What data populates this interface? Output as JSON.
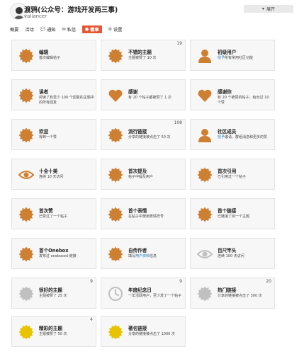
{
  "header": {
    "username": "渡鸦(公众号：游戏开发两三事)",
    "handle": "valiancer",
    "expand_label": "展开"
  },
  "nav": [
    {
      "label": "概要",
      "icon": "",
      "active": false
    },
    {
      "label": "活动",
      "icon": "",
      "active": false
    },
    {
      "label": "通知",
      "icon": "comment-icon",
      "active": false
    },
    {
      "label": "私信",
      "icon": "envelope-icon",
      "active": false
    },
    {
      "label": "徽章",
      "icon": "badge-icon",
      "active": true
    },
    {
      "label": "设置",
      "icon": "gear-icon",
      "active": false
    }
  ],
  "colors": {
    "bronze": "#cd7f32",
    "silver": "#c0c0c0",
    "gold": "#e7c300",
    "accent": "#e45735",
    "link": "#0a74b8"
  },
  "badges": [
    {
      "title": "编辑",
      "desc": "首次编辑帖子",
      "count": "",
      "icon": "cog-icon",
      "color": "bronze"
    },
    {
      "title": "不错的主题",
      "desc": "主题被赞了 10 次",
      "count": "19",
      "icon": "cog-icon",
      "color": "bronze"
    },
    {
      "title": "初级用户",
      "desc_link": "授予",
      "desc": "所有常用社区功能",
      "count": "",
      "icon": "user-icon",
      "color": "bronze"
    },
    {
      "title": "读者",
      "desc": "阅读了有至少 100 个回复的主题中的所有回复",
      "count": "",
      "icon": "cog-icon",
      "color": "bronze"
    },
    {
      "title": "感谢",
      "desc": "有 20 个帖子都被赞了 1 次",
      "count": "",
      "icon": "heart-icon",
      "color": "bronze"
    },
    {
      "title": "感谢你",
      "desc": "有 20 个被赞的帖子，给出过 10 个赞",
      "count": "",
      "icon": "heart-icon",
      "color": "bronze"
    },
    {
      "title": "欢迎",
      "desc": "得到一个赞",
      "count": "",
      "icon": "cog-icon",
      "color": "bronze"
    },
    {
      "title": "流行链接",
      "desc": "分享的链接被点击了 50 次",
      "count": "108",
      "icon": "cog-icon",
      "color": "bronze"
    },
    {
      "title": "社区成员",
      "desc_link": "授予",
      "desc": "邀请、群组消息和更多的赞",
      "count": "",
      "icon": "user-icon",
      "color": "bronze"
    },
    {
      "title": "十全十美",
      "desc": "连续 10 天访问",
      "count": "",
      "icon": "eye-icon",
      "color": "bronze"
    },
    {
      "title": "首次提及",
      "desc": "帖子中提及用户",
      "count": "",
      "icon": "cog-icon",
      "color": "bronze"
    },
    {
      "title": "首次引用",
      "desc": "已引用过一个帖子",
      "count": "",
      "icon": "cog-icon",
      "color": "bronze"
    },
    {
      "title": "首次赞",
      "desc": "已赞过了一个帖子",
      "count": "",
      "icon": "cog-icon",
      "color": "bronze"
    },
    {
      "title": "首个表情",
      "desc": "在帖子中使用表情符号",
      "count": "",
      "icon": "cog-icon",
      "color": "bronze"
    },
    {
      "title": "首个链接",
      "desc": "已链接了另一个主题",
      "count": "",
      "icon": "cog-icon",
      "color": "bronze"
    },
    {
      "title": "首个Onebox",
      "desc": "发布过 oneboxed 链接",
      "count": "",
      "icon": "cog-icon",
      "color": "bronze"
    },
    {
      "title": "自传作者",
      "desc_pre": "填写",
      "desc_link": "用户资料",
      "desc": "信息",
      "count": "",
      "icon": "cog-icon",
      "color": "bronze"
    },
    {
      "title": "百尺竿头",
      "desc": "连续 100 天访问",
      "count": "",
      "icon": "eye-icon",
      "color": "silver"
    },
    {
      "title": "很好的主题",
      "desc": "主题被赞了 25 次",
      "count": "9",
      "icon": "cog-icon",
      "color": "silver"
    },
    {
      "title": "年度纪念日",
      "desc": "一年活跃用户，至少发了一个帖子",
      "count": "9",
      "icon": "clock-icon",
      "color": "silver"
    },
    {
      "title": "热门链接",
      "desc": "分享的链接被点击了 300 次",
      "count": "20",
      "icon": "cog-icon",
      "color": "silver"
    },
    {
      "title": "精彩的主题",
      "desc": "主题被赞了 50 次",
      "count": "4",
      "icon": "cog-icon",
      "color": "gold"
    },
    {
      "title": "著名链接",
      "desc": "分享的链接被点击了 1000 次",
      "count": "",
      "icon": "cog-icon",
      "color": "gold"
    }
  ]
}
